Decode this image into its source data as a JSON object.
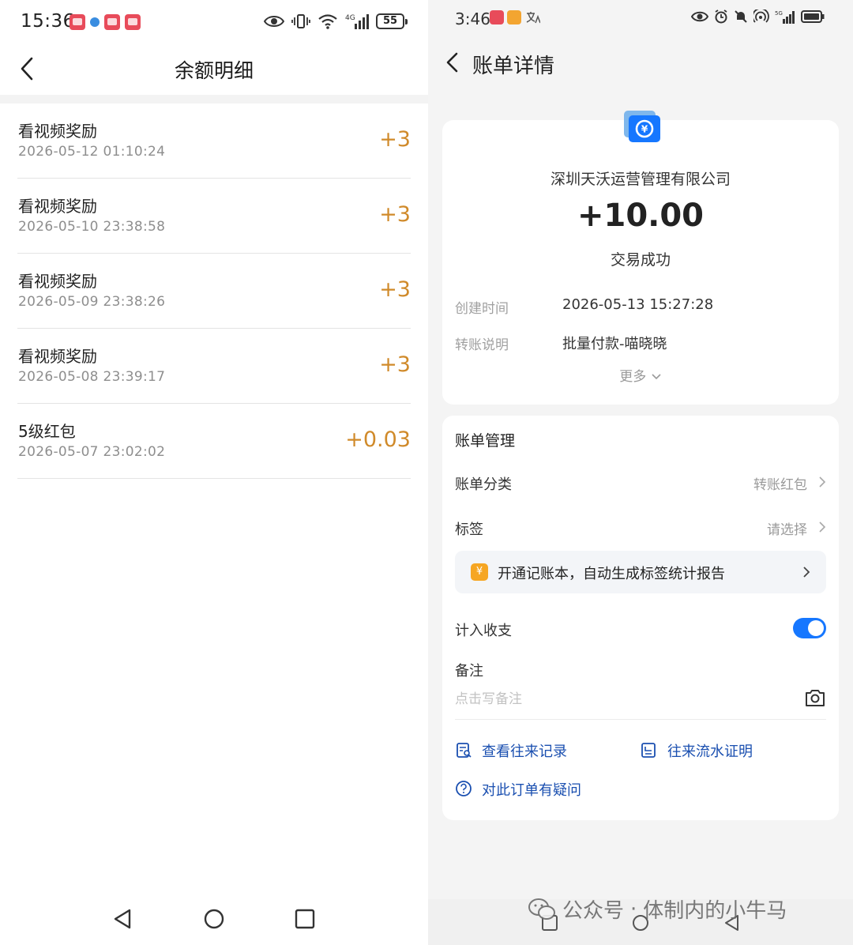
{
  "left": {
    "status": {
      "time": "15:36",
      "battery": "55"
    },
    "title": "余额明细",
    "transactions": [
      {
        "name": "看视频奖励",
        "date": "2026-05-12 01:10:24",
        "amount": "+3"
      },
      {
        "name": "看视频奖励",
        "date": "2026-05-10 23:38:58",
        "amount": "+3"
      },
      {
        "name": "看视频奖励",
        "date": "2026-05-09 23:38:26",
        "amount": "+3"
      },
      {
        "name": "看视频奖励",
        "date": "2026-05-08 23:39:17",
        "amount": "+3"
      },
      {
        "name": "5级红包",
        "date": "2026-05-07 23:02:02",
        "amount": "+0.03"
      }
    ]
  },
  "right": {
    "status": {
      "time": "3:46"
    },
    "title": "账单详情",
    "payee": "深圳天沃运营管理有限公司",
    "amount": "+10.00",
    "status_text": "交易成功",
    "details": [
      {
        "label": "创建时间",
        "value": "2026-05-13 15:27:28"
      },
      {
        "label": "转账说明",
        "value": "批量付款-喵晓晓"
      }
    ],
    "more_label": "更多",
    "manage": {
      "title": "账单管理",
      "category_label": "账单分类",
      "category_value": "转账红包",
      "tag_label": "标签",
      "tag_value": "请选择",
      "promo_icon": "¥",
      "promo_text": "开通记账本，自动生成标签统计报告",
      "count_label": "计入收支",
      "count_enabled": true,
      "note_label": "备注",
      "note_placeholder": "点击写备注",
      "links": {
        "history": "查看往来记录",
        "proof": "往来流水证明",
        "question": "对此订单有疑问"
      }
    }
  },
  "watermark": {
    "account": "公众号",
    "separator": "·",
    "name": "体制内的小牛马"
  },
  "colors": {
    "amount_orange": "#d08a2a",
    "link_blue": "#1a4fb0",
    "toggle_blue": "#1677ff"
  }
}
